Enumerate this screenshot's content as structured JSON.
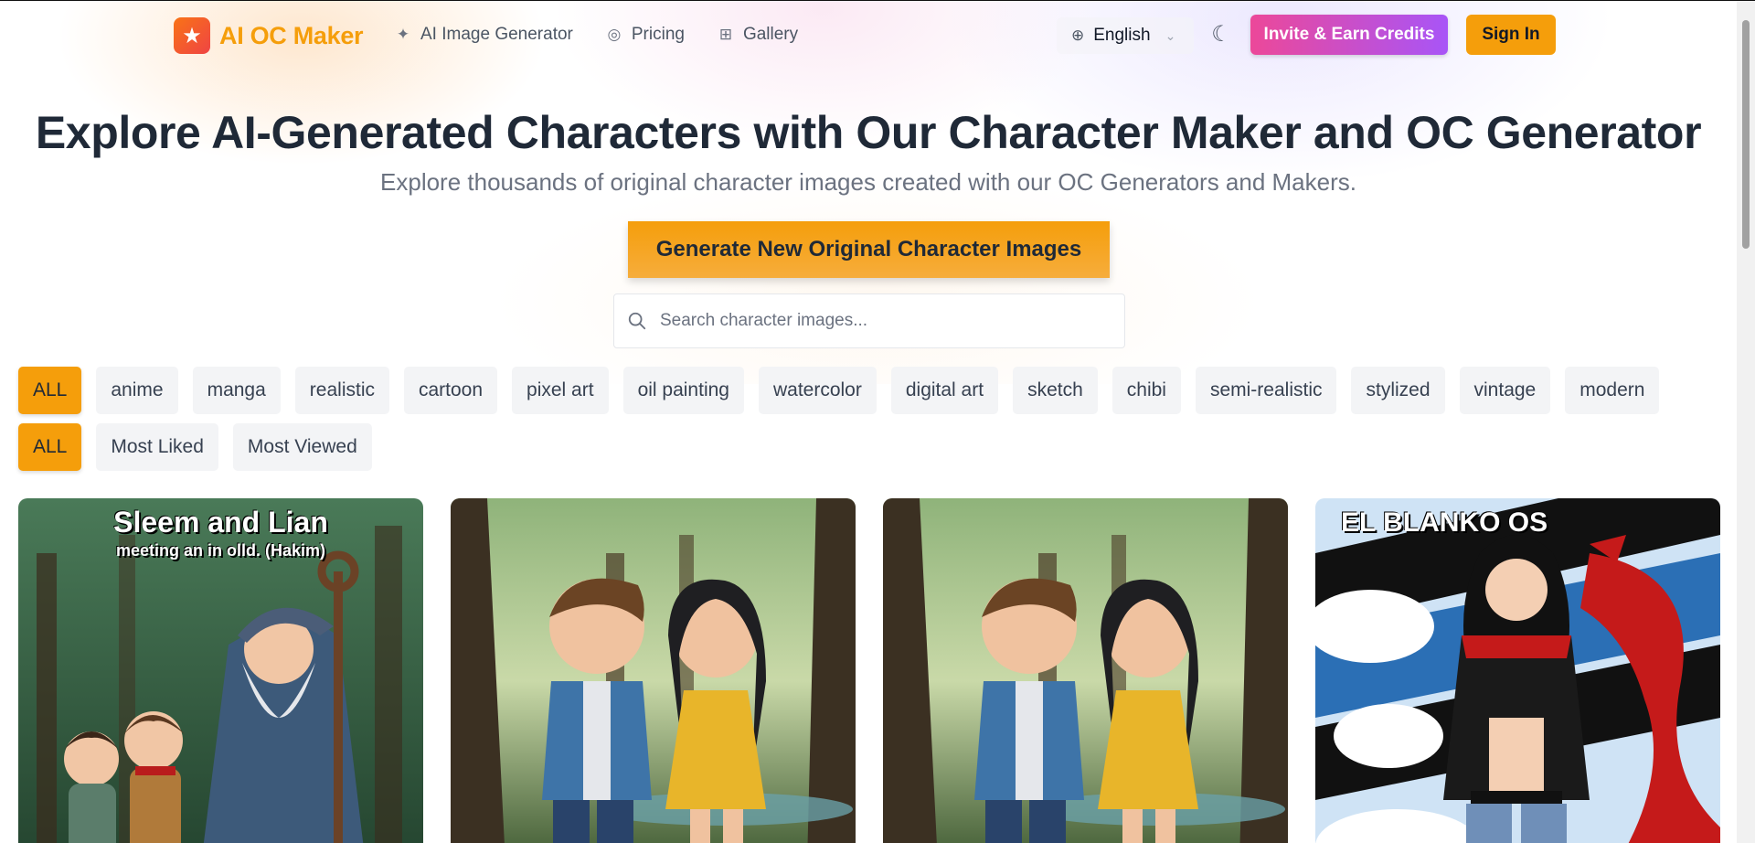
{
  "brand": {
    "name": "AI OC Maker",
    "logo_icon": "star-icon"
  },
  "nav": [
    {
      "label": "AI Image Generator",
      "icon": "sparkles-icon"
    },
    {
      "label": "Pricing",
      "icon": "coin-icon"
    },
    {
      "label": "Gallery",
      "icon": "grid-icon"
    }
  ],
  "header": {
    "language": "English",
    "invite_label": "Invite & Earn Credits",
    "signin_label": "Sign In"
  },
  "hero": {
    "title": "Explore AI-Generated Characters with Our Character Maker and OC Generator",
    "subtitle": "Explore thousands of original character images created with our OC Generators and Makers.",
    "cta_label": "Generate New Original Character Images"
  },
  "search": {
    "placeholder": "Search character images...",
    "value": ""
  },
  "style_filters": [
    "ALL",
    "anime",
    "manga",
    "realistic",
    "cartoon",
    "pixel art",
    "oil painting",
    "watercolor",
    "digital art",
    "sketch",
    "chibi",
    "semi-realistic",
    "stylized",
    "vintage",
    "modern"
  ],
  "sort_filters": [
    "ALL",
    "Most Liked",
    "Most Viewed"
  ],
  "active": {
    "style": "ALL",
    "sort": "ALL"
  },
  "gallery": [
    {
      "caption_title": "Sleem and Lian",
      "caption_sub": "meeting an in olld. (Hakim)"
    },
    {
      "caption_title": "",
      "caption_sub": ""
    },
    {
      "caption_title": "",
      "caption_sub": ""
    },
    {
      "caption_title": "EL BLANKO OS",
      "caption_sub": ""
    }
  ],
  "colors": {
    "accent": "#f59e0b",
    "invite_start": "#ec4899",
    "invite_end": "#a855f7"
  }
}
